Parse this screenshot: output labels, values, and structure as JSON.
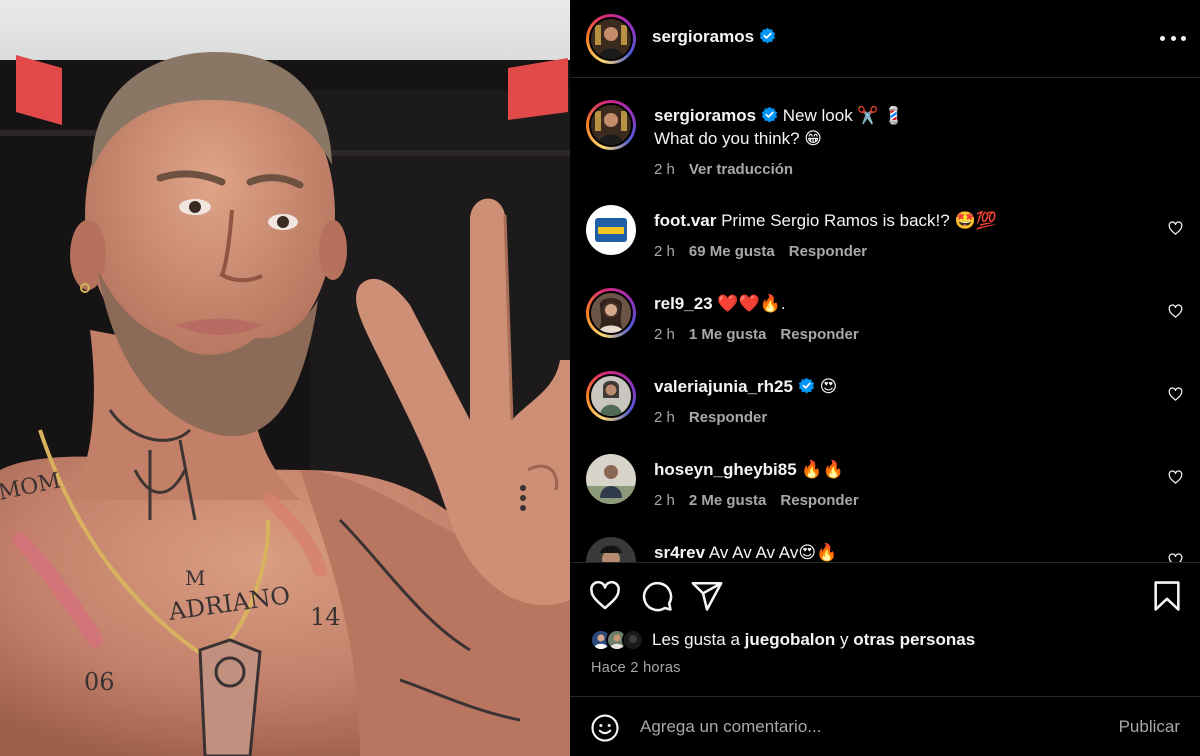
{
  "post": {
    "username": "sergioramos",
    "caption_line1": "New look ✂️ 💈",
    "caption_line2": "What do you think? 😁",
    "caption_time": "2 h",
    "translate_label": "Ver traducción"
  },
  "comments": [
    {
      "username": "foot.var",
      "text": "Prime Sergio Ramos is back!? 🤩💯",
      "time": "2 h",
      "likes": "69 Me gusta",
      "reply": "Responder",
      "verified": false
    },
    {
      "username": "rel9_23",
      "text": "❤️❤️🔥.",
      "time": "2 h",
      "likes": "1 Me gusta",
      "reply": "Responder",
      "verified": false
    },
    {
      "username": "valeriajunia_rh25",
      "text": "😍",
      "time": "2 h",
      "likes": "",
      "reply": "Responder",
      "verified": true
    },
    {
      "username": "hoseyn_gheybi85",
      "text": "🔥🔥",
      "time": "2 h",
      "likes": "2 Me gusta",
      "reply": "Responder",
      "verified": false
    },
    {
      "username": "sr4rev",
      "text": "Av Av Av Av😍🔥",
      "time": "",
      "likes": "",
      "reply": "",
      "verified": false
    }
  ],
  "likes_summary": {
    "prefix": "Les gusta a",
    "user": "juegobalon",
    "conj": "y",
    "others": "otras personas"
  },
  "posted_ago": "Hace 2 horas",
  "add_comment": {
    "placeholder": "Agrega un comentario...",
    "publish_label": "Publicar"
  },
  "icons": [
    "more-options-icon",
    "verified-badge-icon",
    "heart-icon",
    "comment-icon",
    "share-icon",
    "bookmark-icon",
    "emoji-icon"
  ],
  "colors": {
    "background": "#000000",
    "secondary_text": "#a8a8a8",
    "verified": "#0095f6",
    "divider": "#262626"
  }
}
